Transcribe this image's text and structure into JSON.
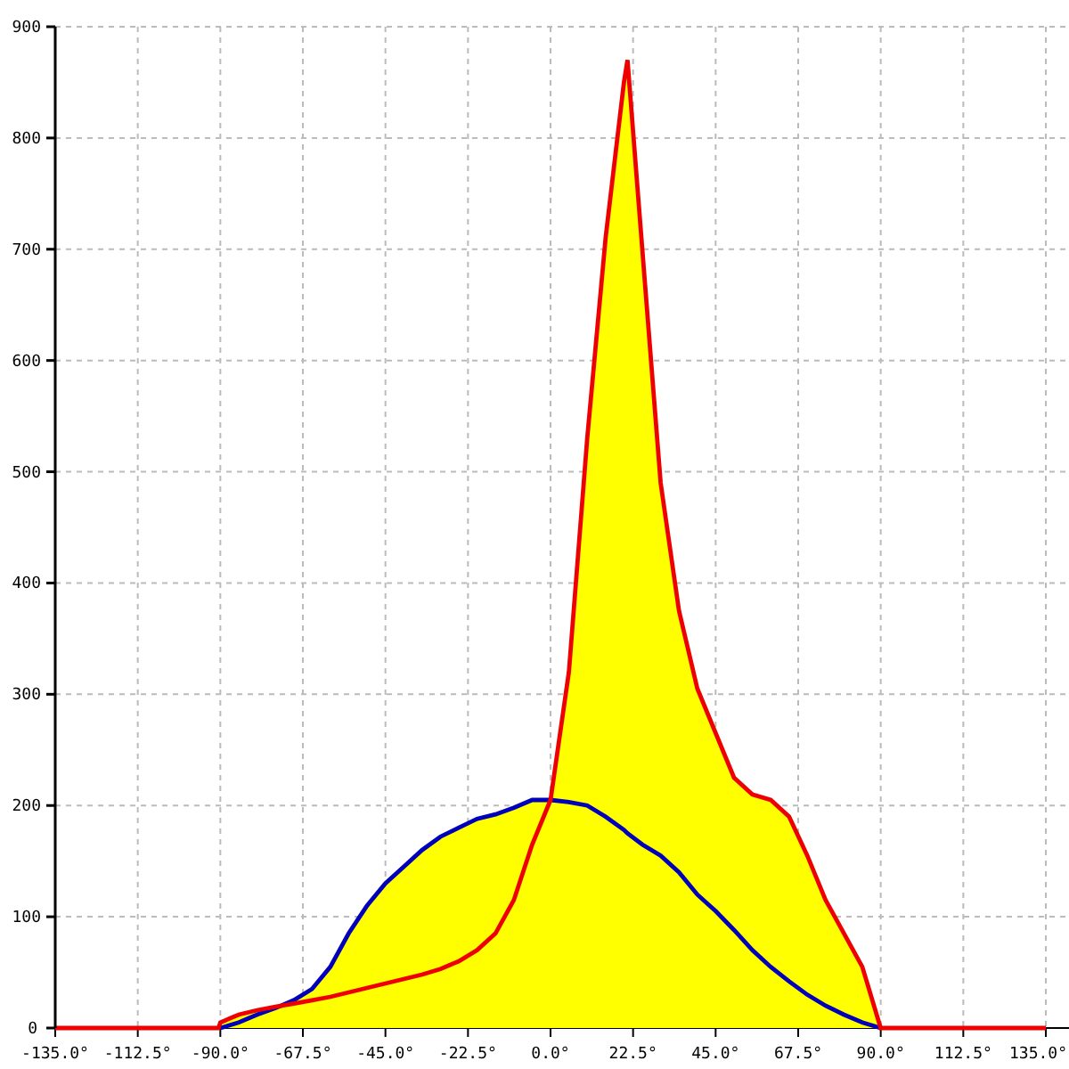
{
  "chart_data": {
    "type": "line",
    "x": [
      -135,
      -90.5,
      -90,
      -85,
      -80,
      -75,
      -70,
      -65,
      -60,
      -55,
      -50,
      -45,
      -40,
      -35,
      -30,
      -25,
      -20,
      -15,
      -10,
      -5,
      0,
      5,
      10,
      15,
      20,
      21,
      25,
      30,
      35,
      40,
      45,
      50,
      55,
      60,
      65,
      70,
      75,
      80,
      85,
      90,
      135
    ],
    "series": [
      {
        "color": "#ee0000",
        "values": [
          0,
          0,
          5,
          12,
          16,
          19,
          22,
          25,
          28,
          32,
          36,
          40,
          44,
          48,
          53,
          60,
          70,
          85,
          115,
          165,
          205,
          320,
          530,
          710,
          850,
          870,
          700,
          490,
          375,
          305,
          265,
          225,
          210,
          205,
          190,
          155,
          115,
          85,
          55,
          0,
          0
        ]
      },
      {
        "color": "#0000bb",
        "values": [
          null,
          null,
          0,
          5,
          12,
          18,
          25,
          35,
          55,
          85,
          110,
          130,
          145,
          160,
          172,
          180,
          188,
          192,
          198,
          205,
          205,
          203,
          200,
          190,
          178,
          175,
          165,
          155,
          140,
          120,
          105,
          88,
          70,
          55,
          42,
          30,
          20,
          12,
          5,
          0,
          null
        ]
      }
    ],
    "grid": true,
    "xlim": [
      -135,
      135
    ],
    "ylim": [
      0,
      900
    ],
    "xticks": [
      {
        "value": -135,
        "label": "-135.0°"
      },
      {
        "value": -112.5,
        "label": "-112.5°"
      },
      {
        "value": -90,
        "label": "-90.0°"
      },
      {
        "value": -67.5,
        "label": "-67.5°"
      },
      {
        "value": -45,
        "label": "-45.0°"
      },
      {
        "value": -22.5,
        "label": "-22.5°"
      },
      {
        "value": 0,
        "label": "0.0°"
      },
      {
        "value": 22.5,
        "label": "22.5°"
      },
      {
        "value": 45,
        "label": "45.0°"
      },
      {
        "value": 67.5,
        "label": "67.5°"
      },
      {
        "value": 90,
        "label": "90.0°"
      },
      {
        "value": 112.5,
        "label": "112.5°"
      },
      {
        "value": 135,
        "label": "135.0°"
      }
    ],
    "yticks": [
      0,
      100,
      200,
      300,
      400,
      500,
      600,
      700,
      800,
      900
    ]
  }
}
